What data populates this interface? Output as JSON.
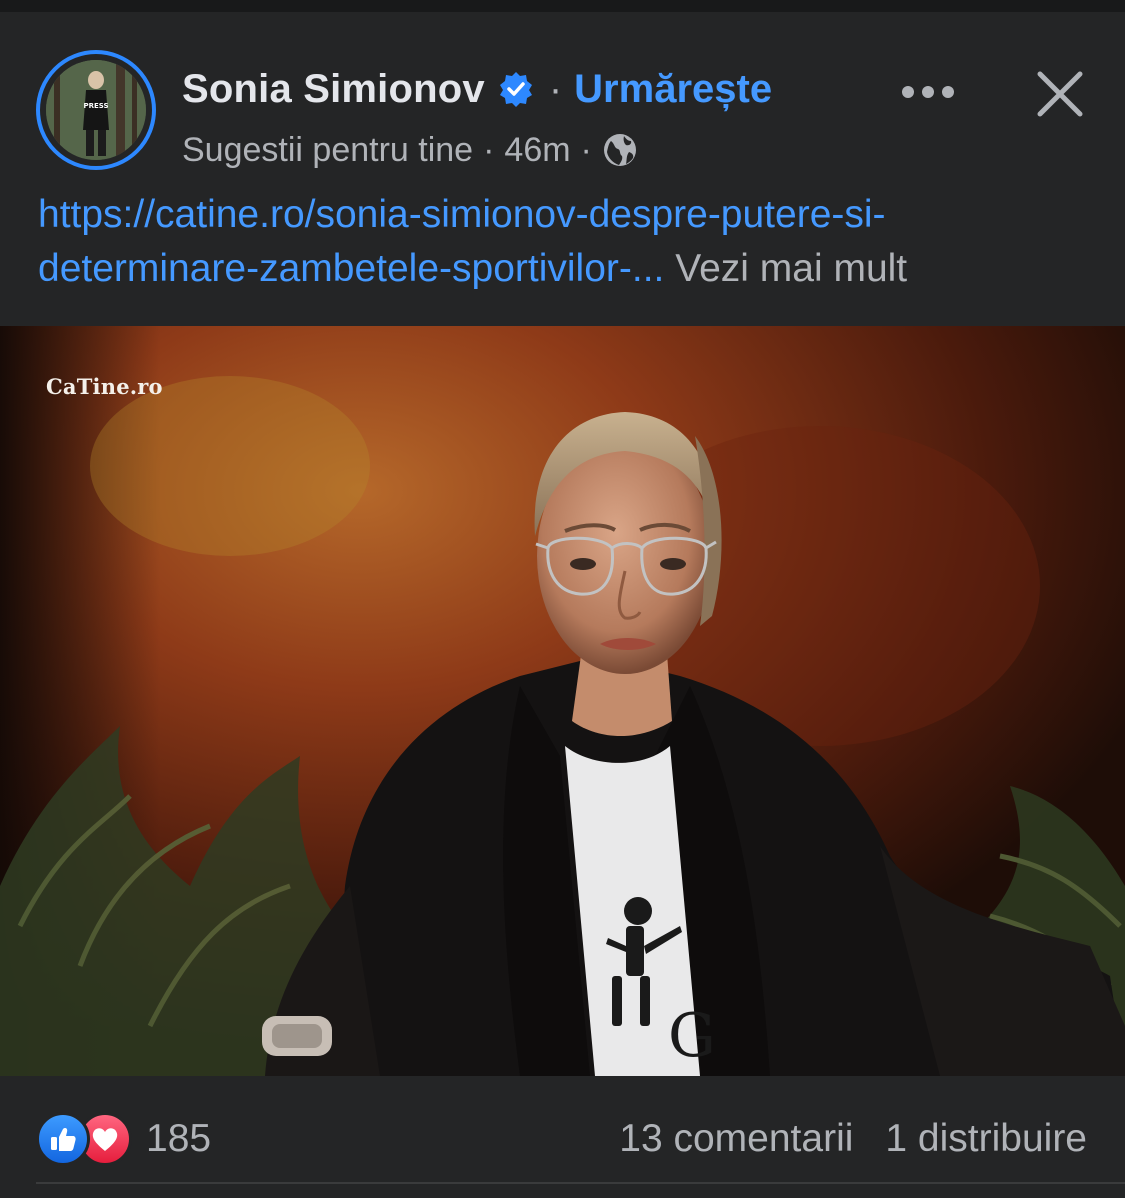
{
  "post": {
    "author_name": "Sonia Simionov",
    "follow_label": "Urmărește",
    "subtitle": "Sugestii pentru tine",
    "time": "46m",
    "caption_link_line1": "https://catine.ro/sonia-simionov-despre-putere-si-",
    "caption_link_line2": "determinare-zambetele-sportivilor-...",
    "see_more": "Vezi mai mult",
    "avatar_text": "PRESS",
    "image_watermark": "CaTine.ro"
  },
  "footer": {
    "reaction_count": "185",
    "comments": "13 comentarii",
    "shares": "1 distribuire"
  },
  "icons": {
    "verified": "verified-badge-icon",
    "audience": "globe-icon",
    "more": "more-options-icon",
    "close": "close-icon",
    "like": "like-reaction-icon",
    "love": "love-reaction-icon"
  },
  "colors": {
    "background": "#242526",
    "link": "#4599ff",
    "text_primary": "#e4e6eb",
    "text_secondary": "#b0b3b8",
    "like": "#1877f2",
    "love": "#f02849"
  }
}
